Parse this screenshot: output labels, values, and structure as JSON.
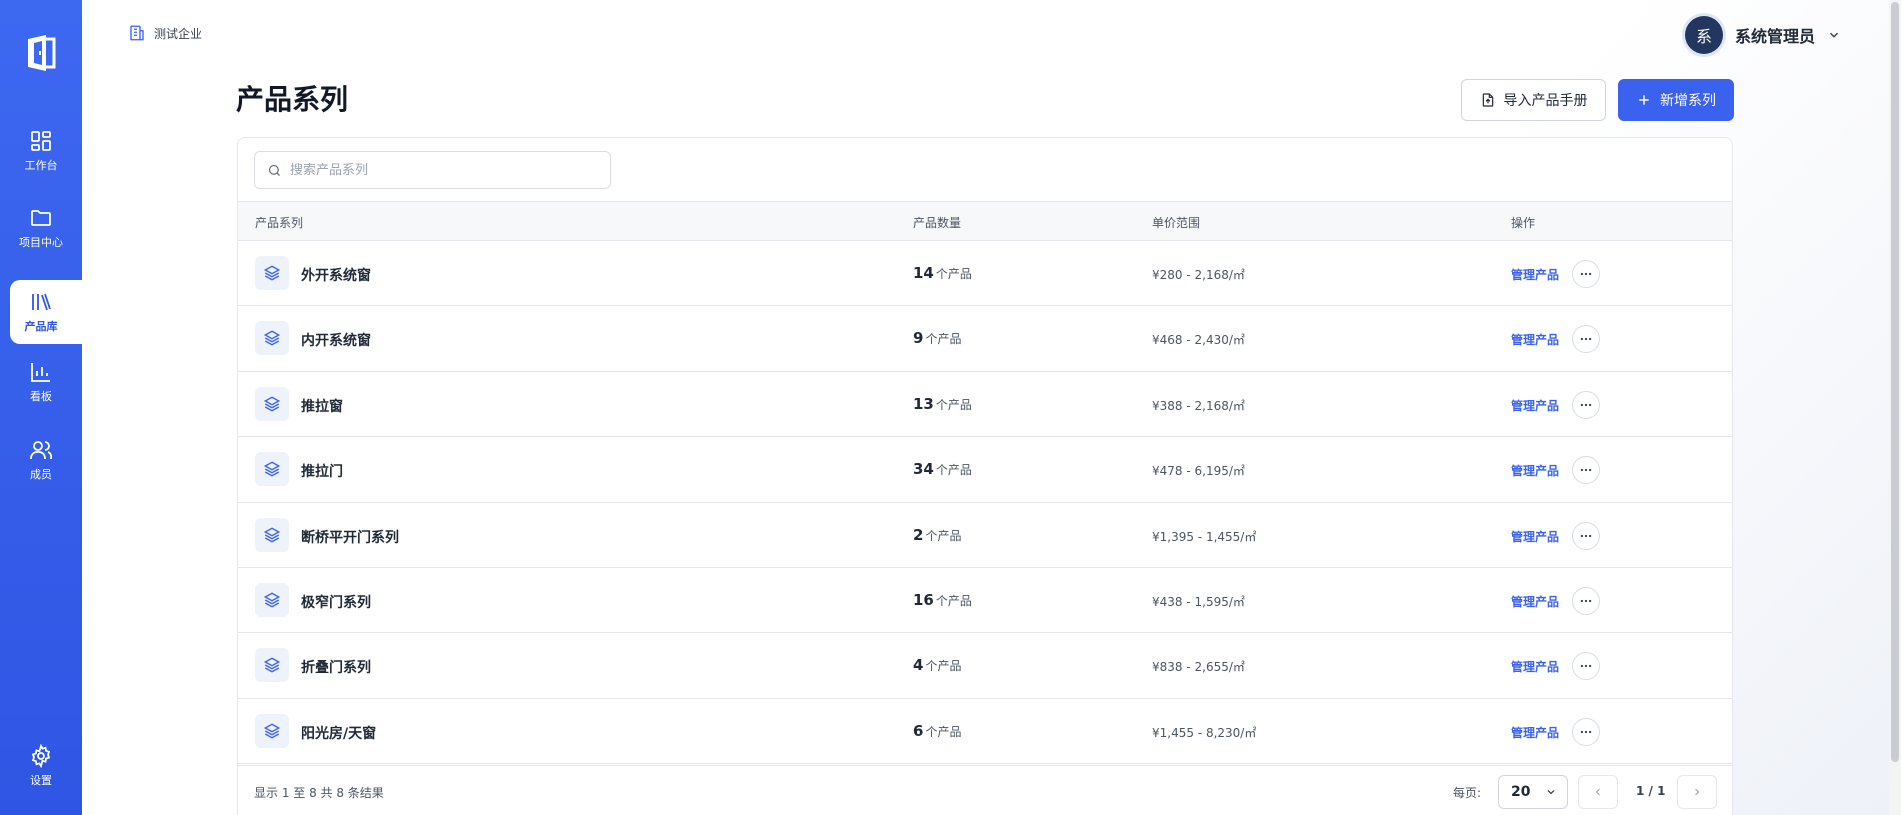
{
  "sidebar": {
    "items": [
      {
        "label": "工作台",
        "icon": "dashboard-icon"
      },
      {
        "label": "项目中心",
        "icon": "folder-icon"
      },
      {
        "label": "产品库",
        "icon": "library-icon",
        "active": true
      },
      {
        "label": "看板",
        "icon": "bar-chart-icon"
      },
      {
        "label": "成员",
        "icon": "users-icon"
      }
    ],
    "settings_label": "设置"
  },
  "header": {
    "org_name": "测试企业",
    "user_avatar": "系",
    "user_name": "系统管理员"
  },
  "page": {
    "title": "产品系列",
    "import_label": "导入产品手册",
    "add_label": "新增系列"
  },
  "search": {
    "placeholder": "搜索产品系列",
    "value": ""
  },
  "table": {
    "columns": [
      "产品系列",
      "产品数量",
      "单价范围",
      "操作"
    ],
    "count_unit": "个产品",
    "manage_label": "管理产品",
    "rows": [
      {
        "name": "外开系统窗",
        "count": "14",
        "price": "¥280 - 2,168/㎡"
      },
      {
        "name": "内开系统窗",
        "count": "9",
        "price": "¥468 - 2,430/㎡"
      },
      {
        "name": "推拉窗",
        "count": "13",
        "price": "¥388 - 2,168/㎡"
      },
      {
        "name": "推拉门",
        "count": "34",
        "price": "¥478 - 6,195/㎡"
      },
      {
        "name": "断桥平开门系列",
        "count": "2",
        "price": "¥1,395 - 1,455/㎡"
      },
      {
        "name": "极窄门系列",
        "count": "16",
        "price": "¥438 - 1,595/㎡"
      },
      {
        "name": "折叠门系列",
        "count": "4",
        "price": "¥838 - 2,655/㎡"
      },
      {
        "name": "阳光房/天窗",
        "count": "6",
        "price": "¥1,455 - 8,230/㎡"
      }
    ]
  },
  "pagination": {
    "summary": "显示 1 至 8 共 8 条结果",
    "per_page_label": "每页:",
    "per_page_value": "20",
    "page_info": "1 / 1"
  },
  "colors": {
    "brand": "#3b62ee",
    "sidebar": "#2f55e4"
  }
}
